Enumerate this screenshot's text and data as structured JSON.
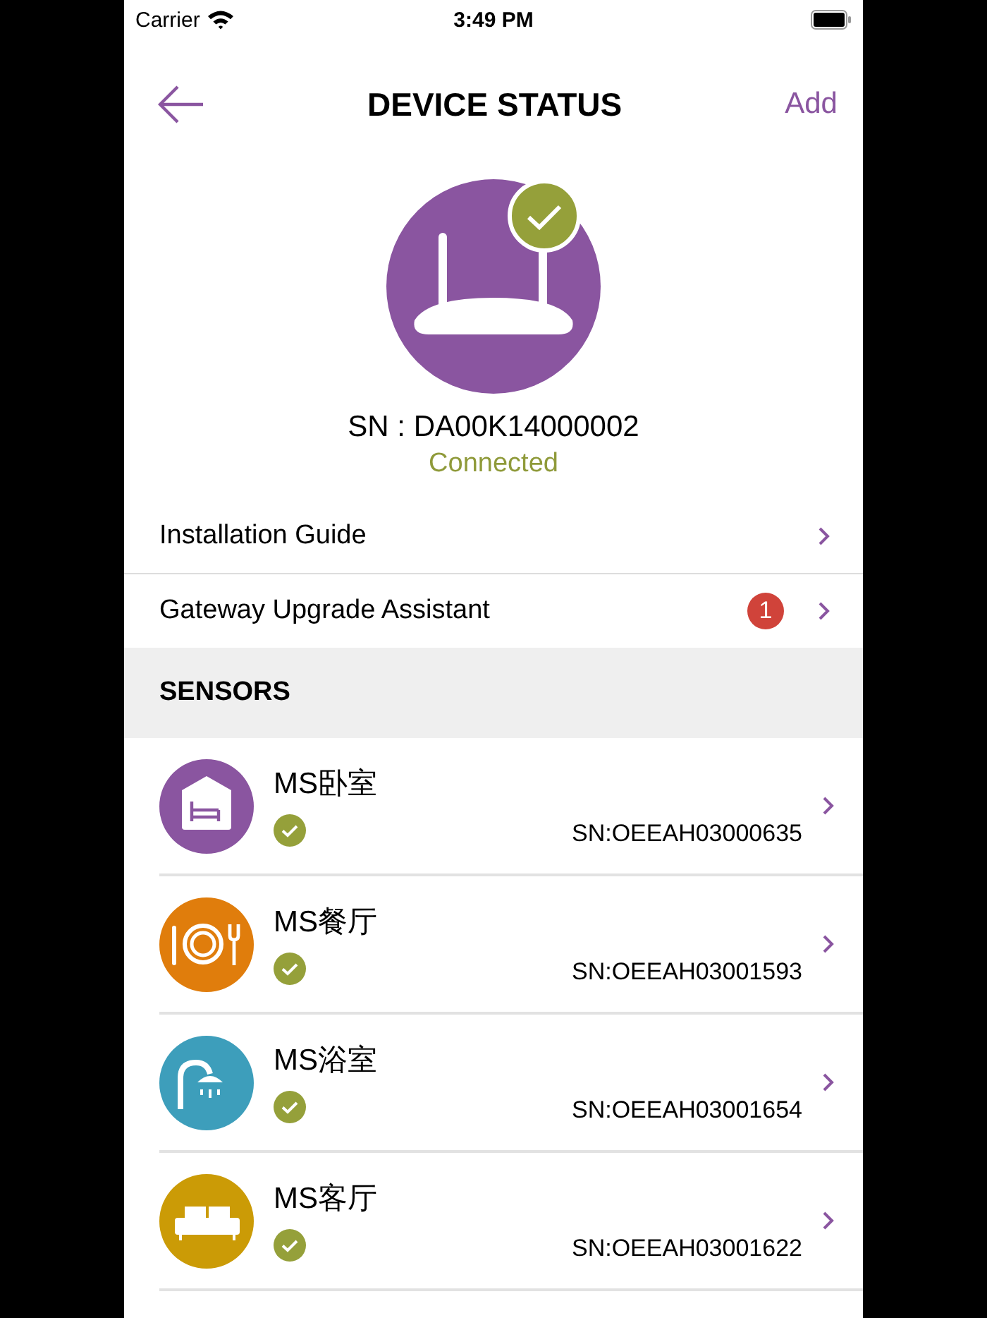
{
  "status_bar": {
    "carrier": "Carrier",
    "time": "3:49 PM"
  },
  "nav": {
    "title": "DEVICE STATUS",
    "action": "Add"
  },
  "gateway": {
    "serial": "SN : DA00K14000002",
    "status": "Connected",
    "connected": true
  },
  "menu": [
    {
      "label": "Installation Guide"
    },
    {
      "label": "Gateway Upgrade Assistant",
      "badge": "1"
    }
  ],
  "sensors_header": "SENSORS",
  "sensors": [
    {
      "kind": "bedroom",
      "name": "MS卧室",
      "serial": "SN:OEEAH03000635",
      "ok": true
    },
    {
      "kind": "dining",
      "name": "MS餐厅",
      "serial": "SN:OEEAH03001593",
      "ok": true
    },
    {
      "kind": "bathroom",
      "name": "MS浴室",
      "serial": "SN:OEEAH03001654",
      "ok": true
    },
    {
      "kind": "living",
      "name": "MS客厅",
      "serial": "SN:OEEAH03001622",
      "ok": true
    }
  ]
}
